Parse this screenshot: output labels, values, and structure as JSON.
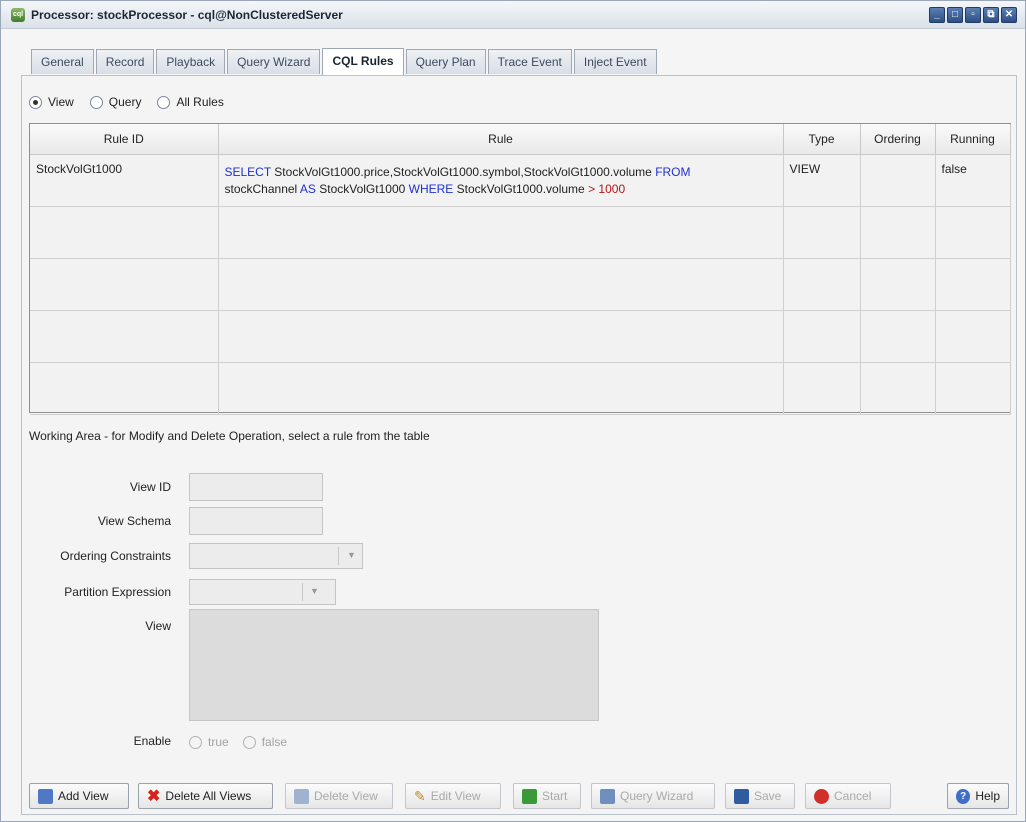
{
  "window": {
    "title": "Processor: stockProcessor - cql@NonClusteredServer",
    "icon_text": "cql"
  },
  "tabs": [
    "General",
    "Record",
    "Playback",
    "Query Wizard",
    "CQL Rules",
    "Query Plan",
    "Trace Event",
    "Inject Event"
  ],
  "active_tab": "CQL Rules",
  "filters": {
    "view": "View",
    "query": "Query",
    "all_rules": "All Rules",
    "selected": "View"
  },
  "table": {
    "columns": [
      "Rule ID",
      "Rule",
      "Type",
      "Ordering",
      "Running"
    ],
    "rows": [
      {
        "rule_id": "StockVolGt1000",
        "rule_line1": {
          "k1": "SELECT",
          "t1": " StockVolGt1000.price,StockVolGt1000.symbol,StockVolGt1000.volume ",
          "k2": "FROM"
        },
        "rule_line2": {
          "t1": "stockChannel ",
          "k1": "AS",
          "t2": " StockVolGt1000 ",
          "k2": "WHERE",
          "t3": " StockVolGt1000.volume ",
          "op": ">",
          "num": "1000"
        },
        "type": "VIEW",
        "ordering": "",
        "running": "false"
      }
    ]
  },
  "working_area": {
    "label": "Working Area - for Modify and Delete Operation, select a rule from the table",
    "view_id_label": "View ID",
    "view_schema_label": "View Schema",
    "ordering_label": "Ordering Constraints",
    "partition_label": "Partition Expression",
    "view_label": "View",
    "enable_label": "Enable",
    "enable_true": "true",
    "enable_false": "false"
  },
  "buttons": {
    "add_view": "Add View",
    "delete_all": "Delete All Views",
    "delete_view": "Delete View",
    "edit_view": "Edit View",
    "start": "Start",
    "query_wizard": "Query Wizard",
    "save": "Save",
    "cancel": "Cancel",
    "help": "Help"
  }
}
